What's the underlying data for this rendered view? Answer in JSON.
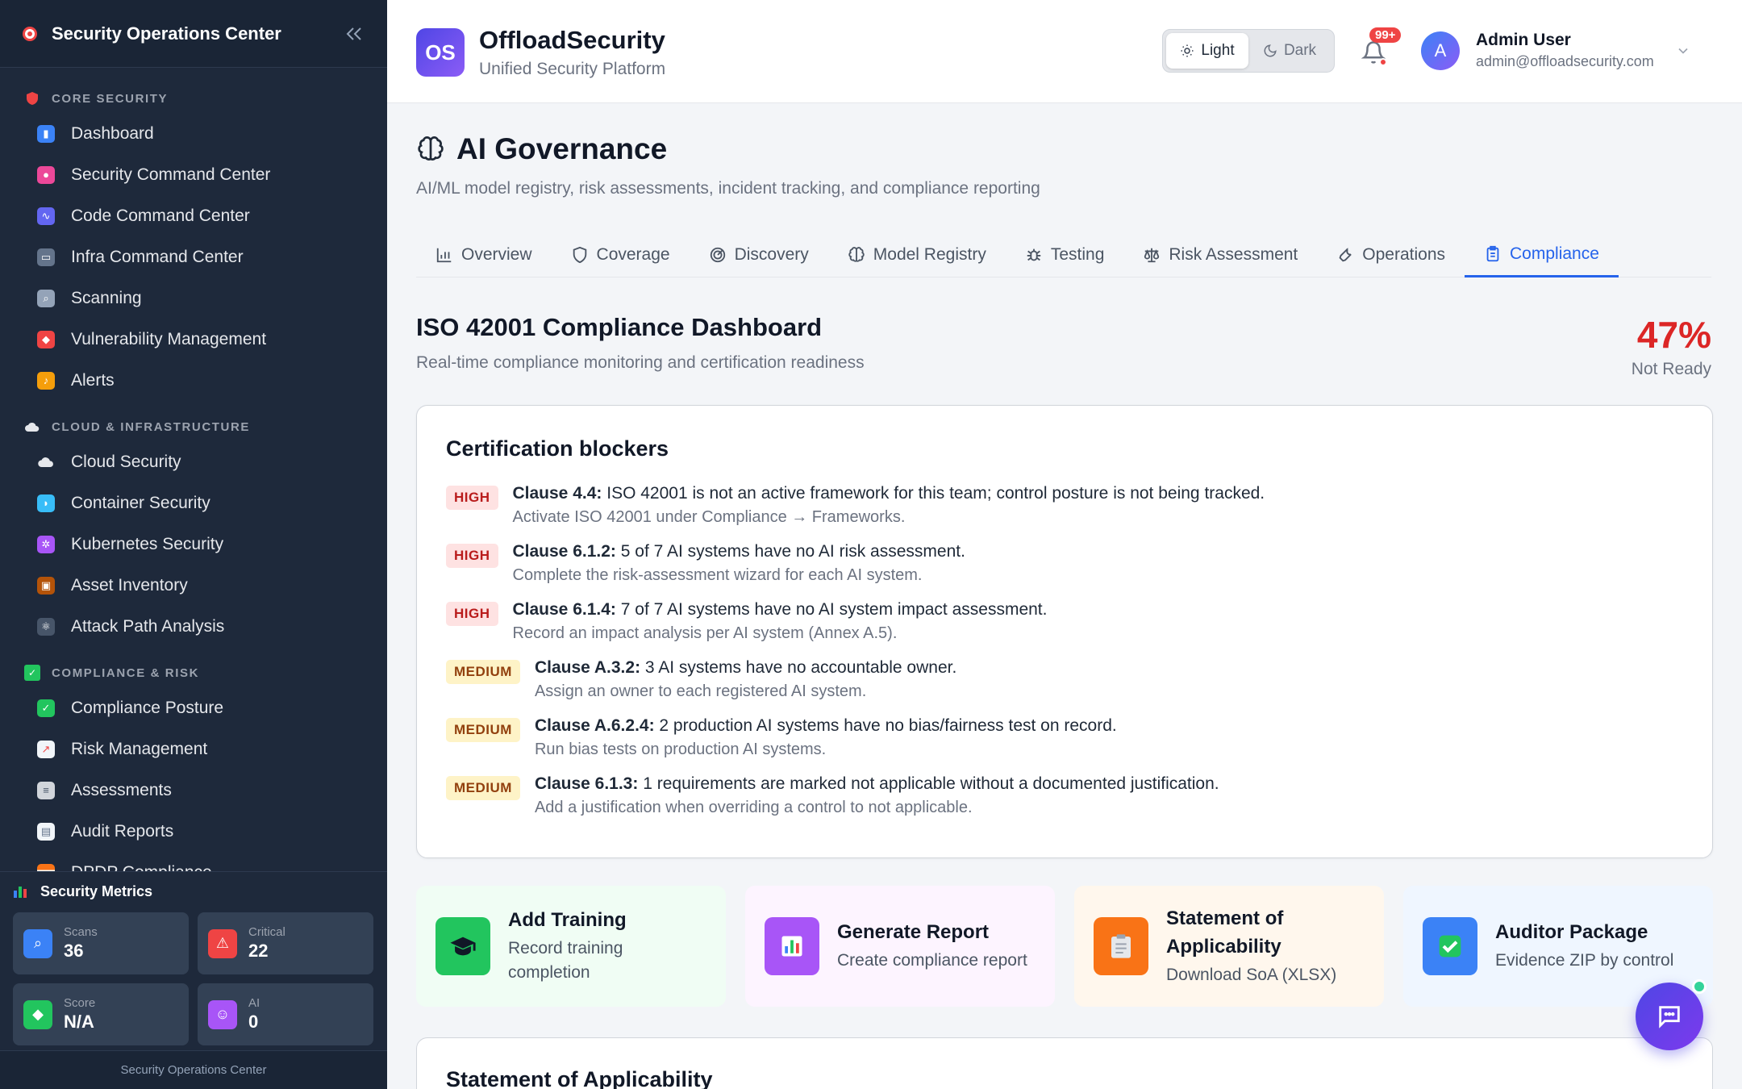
{
  "sidebar": {
    "title": "Security Operations Center",
    "sections": [
      {
        "label": "CORE SECURITY",
        "icon": "shield-icon",
        "items": [
          {
            "label": "Dashboard",
            "icon": "bar-chart-icon",
            "color": "#3b82f6"
          },
          {
            "label": "Security Command Center",
            "icon": "brain-icon",
            "color": "#ec4899"
          },
          {
            "label": "Code Command Center",
            "icon": "dna-icon",
            "color": "#6366f1"
          },
          {
            "label": "Infra Command Center",
            "icon": "monitor-icon",
            "color": "#64748b"
          },
          {
            "label": "Scanning",
            "icon": "magnifier-icon",
            "color": "#94a3b8"
          },
          {
            "label": "Vulnerability Management",
            "icon": "shield-icon",
            "color": "#ef4444"
          },
          {
            "label": "Alerts",
            "icon": "bell-icon",
            "color": "#f59e0b"
          }
        ]
      },
      {
        "label": "CLOUD & INFRASTRUCTURE",
        "icon": "cloud-icon",
        "items": [
          {
            "label": "Cloud Security",
            "icon": "cloud-icon",
            "color": "#e5e7eb"
          },
          {
            "label": "Container Security",
            "icon": "whale-icon",
            "color": "#38bdf8"
          },
          {
            "label": "Kubernetes Security",
            "icon": "helm-icon",
            "color": "#a855f7"
          },
          {
            "label": "Asset Inventory",
            "icon": "package-icon",
            "color": "#b45309"
          },
          {
            "label": "Attack Path Analysis",
            "icon": "atom-icon",
            "color": "#64748b"
          }
        ]
      },
      {
        "label": "COMPLIANCE & RISK",
        "icon": "checkmark-icon",
        "items": [
          {
            "label": "Compliance Posture",
            "icon": "checkmark-icon",
            "color": "#22c55e"
          },
          {
            "label": "Risk Management",
            "icon": "trend-chart-icon",
            "color": "#e5e7eb"
          },
          {
            "label": "Assessments",
            "icon": "clipboard-icon",
            "color": "#d1d5db"
          },
          {
            "label": "Audit Reports",
            "icon": "document-icon",
            "color": "#e5e7eb"
          },
          {
            "label": "DPDP Compliance",
            "icon": "india-flag-icon",
            "color": "#f97316"
          }
        ]
      }
    ],
    "metrics_title": "Security Metrics",
    "metrics": [
      {
        "label": "Scans",
        "value": "36",
        "icon": "magnifier-icon",
        "color": "#3b82f6"
      },
      {
        "label": "Critical",
        "value": "22",
        "icon": "warning-icon",
        "color": "#ef4444"
      },
      {
        "label": "Score",
        "value": "N/A",
        "icon": "shield-icon",
        "color": "#22c55e"
      },
      {
        "label": "AI",
        "value": "0",
        "icon": "robot-icon",
        "color": "#a855f7"
      }
    ],
    "footer": "Security Operations Center"
  },
  "header": {
    "brand_initials": "OS",
    "brand_name": "OffloadSecurity",
    "brand_tagline": "Unified Security Platform",
    "theme_light": "Light",
    "theme_dark": "Dark",
    "notifications_badge": "99+",
    "user_initial": "A",
    "user_name": "Admin User",
    "user_email": "admin@offloadsecurity.com"
  },
  "page": {
    "title": "AI Governance",
    "description": "AI/ML model registry, risk assessments, incident tracking, and compliance reporting",
    "tabs": [
      {
        "label": "Overview",
        "icon": "bar-chart-icon"
      },
      {
        "label": "Coverage",
        "icon": "shield-icon"
      },
      {
        "label": "Discovery",
        "icon": "radar-icon"
      },
      {
        "label": "Model Registry",
        "icon": "brain-icon"
      },
      {
        "label": "Testing",
        "icon": "bug-icon"
      },
      {
        "label": "Risk Assessment",
        "icon": "scale-icon"
      },
      {
        "label": "Operations",
        "icon": "wrench-icon"
      },
      {
        "label": "Compliance",
        "icon": "clipboard-icon",
        "active": true
      }
    ]
  },
  "compliance": {
    "title": "ISO 42001 Compliance Dashboard",
    "subtitle": "Real-time compliance monitoring and certification readiness",
    "score": "47%",
    "status": "Not Ready",
    "score_color": "#dc2626",
    "blockers_title": "Certification blockers",
    "blockers": [
      {
        "severity": "HIGH",
        "clause": "Clause 4.4:",
        "text": "ISO 42001 is not an active framework for this team; control posture is not being tracked.",
        "hint": "Activate ISO 42001 under Compliance → Frameworks."
      },
      {
        "severity": "HIGH",
        "clause": "Clause 6.1.2:",
        "text": "5 of 7 AI systems have no AI risk assessment.",
        "hint": "Complete the risk-assessment wizard for each AI system."
      },
      {
        "severity": "HIGH",
        "clause": "Clause 6.1.4:",
        "text": "7 of 7 AI systems have no AI system impact assessment.",
        "hint": "Record an impact analysis per AI system (Annex A.5)."
      },
      {
        "severity": "MEDIUM",
        "clause": "Clause A.3.2:",
        "text": "3 AI systems have no accountable owner.",
        "hint": "Assign an owner to each registered AI system."
      },
      {
        "severity": "MEDIUM",
        "clause": "Clause A.6.2.4:",
        "text": "2 production AI systems have no bias/fairness test on record.",
        "hint": "Run bias tests on production AI systems."
      },
      {
        "severity": "MEDIUM",
        "clause": "Clause 6.1.3:",
        "text": "1 requirements are marked not applicable without a documented justification.",
        "hint": "Add a justification when overriding a control to not applicable."
      }
    ],
    "actions": [
      {
        "title": "Add Training",
        "subtitle": "Record training completion",
        "icon": "graduation-cap-icon",
        "bg": "#f0fdf4",
        "icon_bg": "#22c55e"
      },
      {
        "title": "Generate Report",
        "subtitle": "Create compliance report",
        "icon": "bar-chart-icon",
        "bg": "#fdf4ff",
        "icon_bg": "#a855f7"
      },
      {
        "title": "Statement of Applicability",
        "subtitle": "Download SoA (XLSX)",
        "icon": "clipboard-icon",
        "bg": "#fff7ed",
        "icon_bg": "#f97316"
      },
      {
        "title": "Auditor Package",
        "subtitle": "Evidence ZIP by control",
        "icon": "checkmark-icon",
        "bg": "#eff6ff",
        "icon_bg": "#3b82f6"
      }
    ],
    "soa_title": "Statement of Applicability"
  }
}
